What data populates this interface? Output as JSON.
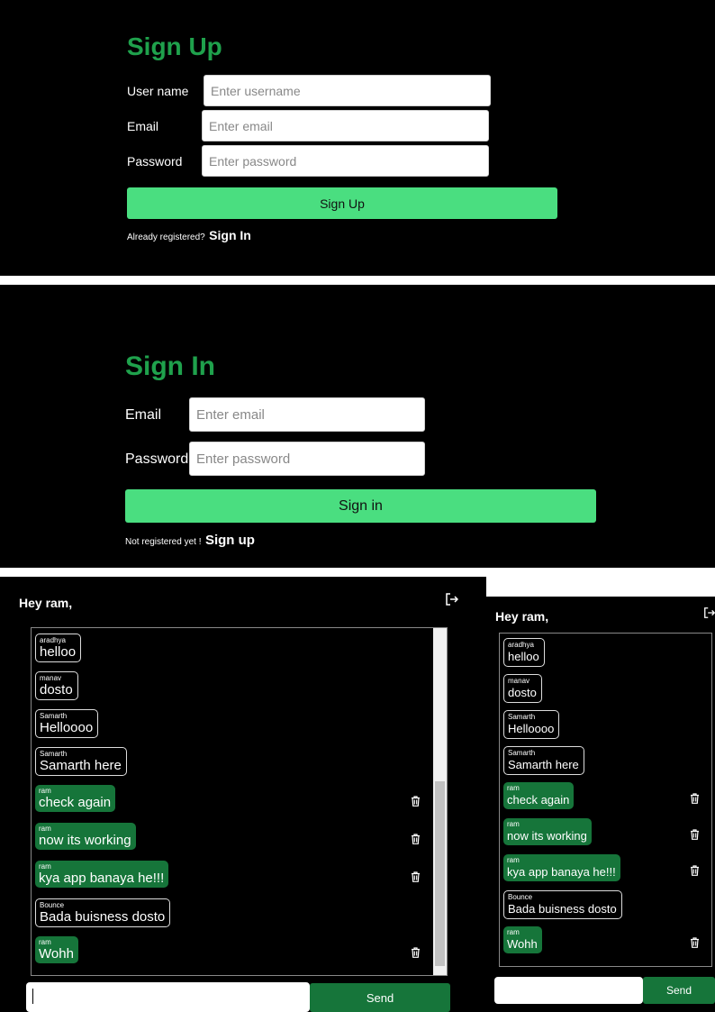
{
  "signup": {
    "title": "Sign Up",
    "username_label": "User name",
    "username_placeholder": "Enter username",
    "email_label": "Email",
    "email_placeholder": "Enter email",
    "password_label": "Password",
    "password_placeholder": "Enter password",
    "button": "Sign Up",
    "footer_text": "Already registered?",
    "footer_link": "Sign In"
  },
  "signin": {
    "title": "Sign In",
    "email_label": "Email",
    "email_placeholder": "Enter email",
    "password_label": "Password",
    "password_placeholder": "Enter password",
    "button": "Sign in",
    "footer_text": "Not registered yet !",
    "footer_link": "Sign up"
  },
  "chat": {
    "greeting": "Hey ram,",
    "logout_icon": "logout-icon",
    "send_label": "Send",
    "messages": [
      {
        "user": "aradhya",
        "text": "helloo",
        "mine": false
      },
      {
        "user": "manav",
        "text": "dosto",
        "mine": false
      },
      {
        "user": "Samarth",
        "text": "Helloooo",
        "mine": false
      },
      {
        "user": "Samarth",
        "text": "Samarth here",
        "mine": false
      },
      {
        "user": "ram",
        "text": "check again",
        "mine": true
      },
      {
        "user": "ram",
        "text": "now its working",
        "mine": true
      },
      {
        "user": "ram",
        "text": "kya app banaya he!!!",
        "mine": true
      },
      {
        "user": "Bounce",
        "text": "Bada buisness dosto",
        "mine": false
      },
      {
        "user": "ram",
        "text": "Wohh",
        "mine": true
      }
    ]
  },
  "chat_small": {
    "greeting": "Hey ram,",
    "send_label": "Send"
  },
  "colors": {
    "title_green": "#1fa14c",
    "button_green": "#4ade80",
    "own_message": "#16753a"
  }
}
